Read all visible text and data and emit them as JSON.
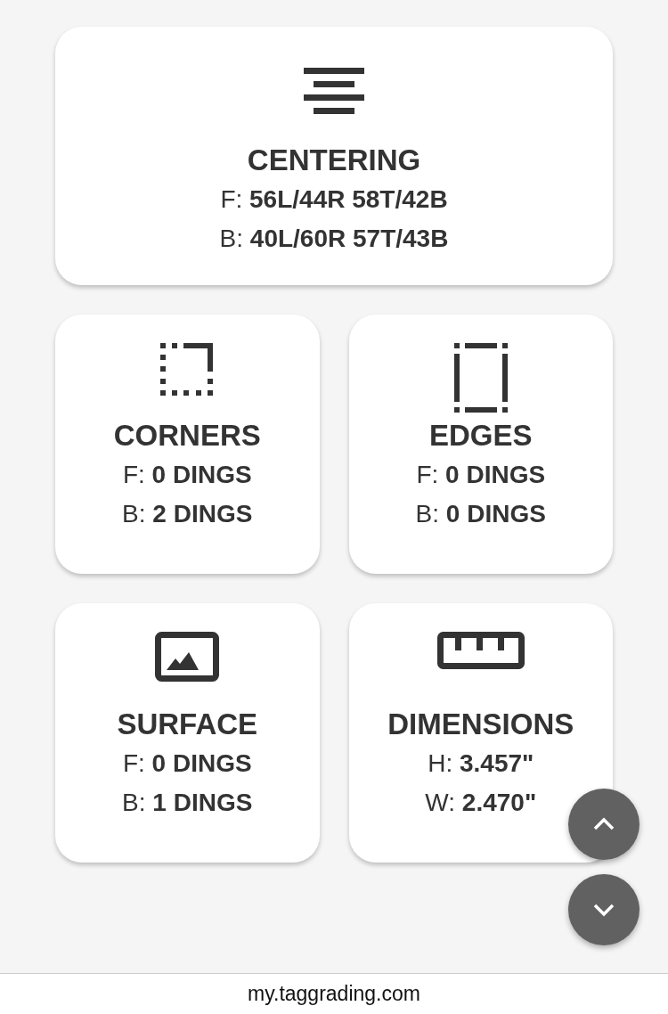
{
  "cards": [
    {
      "kind": "centering",
      "title": "CENTERING",
      "lines": [
        {
          "label": "F:",
          "value": "56L/44R 58T/42B"
        },
        {
          "label": "B:",
          "value": "40L/60R 57T/43B"
        }
      ]
    },
    {
      "kind": "corners",
      "title": "CORNERS",
      "lines": [
        {
          "label": "F:",
          "value": "0 DINGS"
        },
        {
          "label": "B:",
          "value": "2 DINGS"
        }
      ]
    },
    {
      "kind": "edges",
      "title": "EDGES",
      "lines": [
        {
          "label": "F:",
          "value": "0 DINGS"
        },
        {
          "label": "B:",
          "value": "0 DINGS"
        }
      ]
    },
    {
      "kind": "surface",
      "title": "SURFACE",
      "lines": [
        {
          "label": "F:",
          "value": "0 DINGS"
        },
        {
          "label": "B:",
          "value": "1 DINGS"
        }
      ]
    },
    {
      "kind": "dimensions",
      "title": "DIMENSIONS",
      "lines": [
        {
          "label": "H:",
          "value": "3.457\""
        },
        {
          "label": "W:",
          "value": "2.470\""
        }
      ]
    }
  ],
  "address_bar": {
    "url": "my.taggrading.com"
  }
}
